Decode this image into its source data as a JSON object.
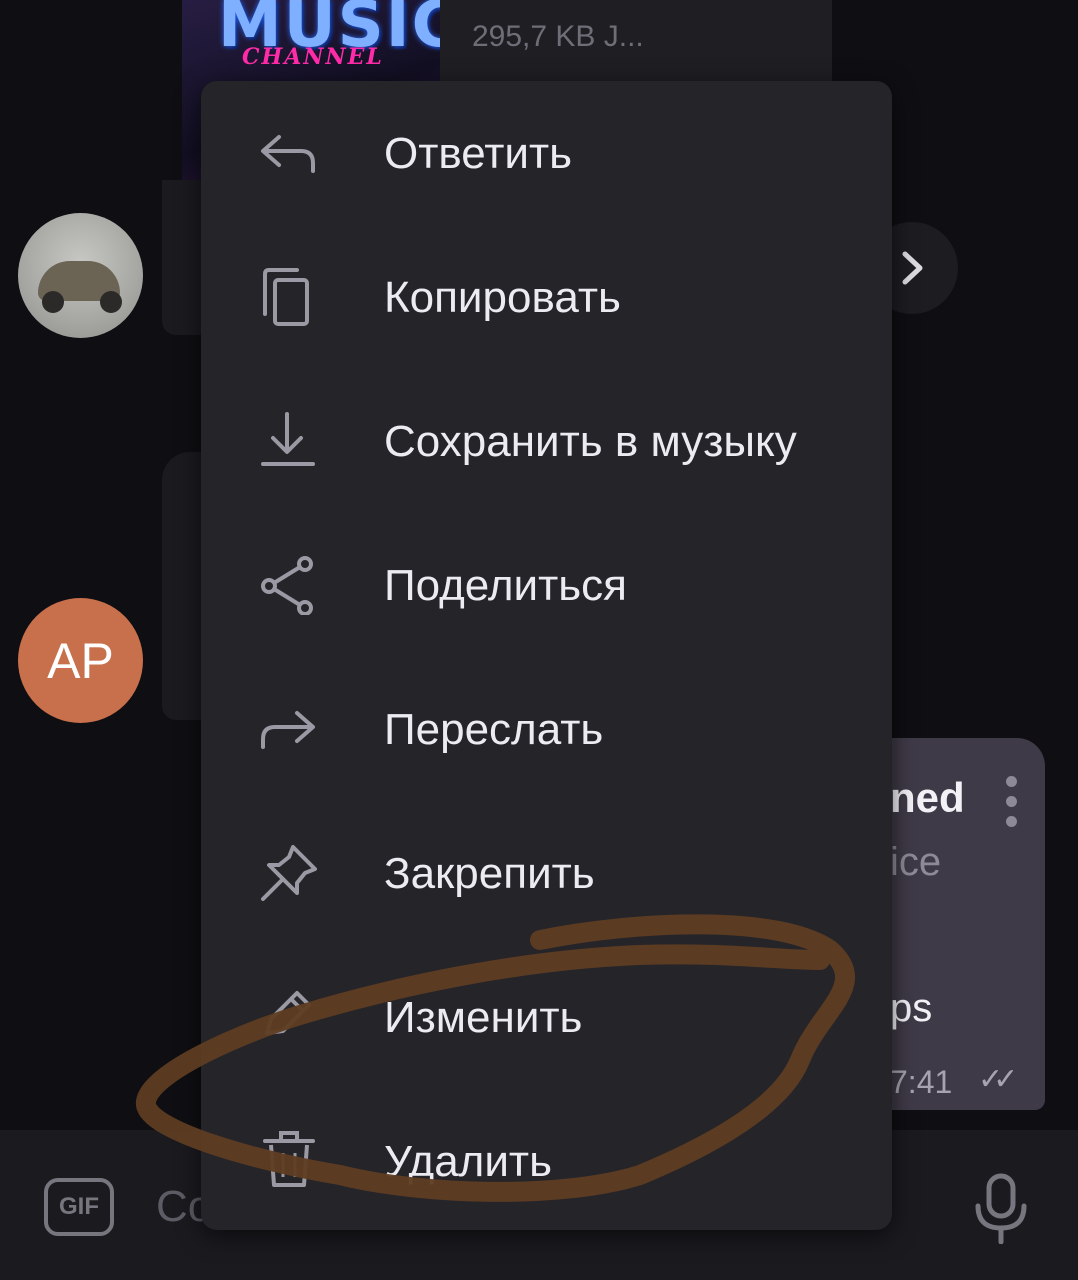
{
  "music_card": {
    "thumb_title": "MUSIC",
    "thumb_subtitle": "CHANNEL",
    "meta": "295,7 KB J..."
  },
  "avatars": {
    "second_initials": "AP"
  },
  "sent_message": {
    "line1": "ned",
    "line2": "ice",
    "line3": "ps",
    "time": "7:41",
    "checks": "✓✓"
  },
  "context_menu": {
    "items": [
      {
        "label": "Ответить",
        "icon": "reply-icon"
      },
      {
        "label": "Копировать",
        "icon": "copy-icon"
      },
      {
        "label": "Сохранить в музыку",
        "icon": "download-icon"
      },
      {
        "label": "Поделиться",
        "icon": "share-icon"
      },
      {
        "label": "Переслать",
        "icon": "forward-icon"
      },
      {
        "label": "Закрепить",
        "icon": "pin-icon"
      },
      {
        "label": "Изменить",
        "icon": "edit-icon"
      },
      {
        "label": "Удалить",
        "icon": "trash-icon"
      }
    ]
  },
  "input_bar": {
    "gif_label": "GIF",
    "placeholder": "Сообщение"
  },
  "annotation": {
    "color": "#5e3d22"
  },
  "colors": {
    "background": "#0f0e12",
    "menu_bg": "#252429",
    "menu_text": "#ecebf1",
    "icon": "#9b99a3",
    "avatar_ap": "#c86f4c",
    "my_bubble": "#3f3a47"
  }
}
